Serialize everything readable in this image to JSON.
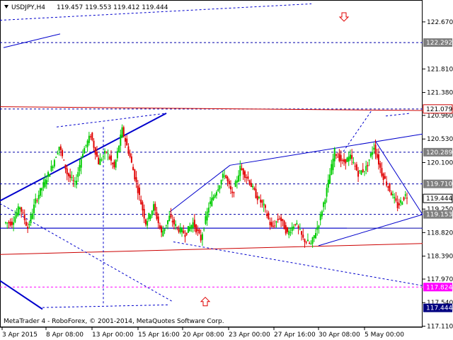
{
  "header": {
    "symbol": "USDJPY,H4",
    "ohlc": "119.457 119.553 119.412 119.444"
  },
  "footer": {
    "copyright": "MetaTrader 4 - RoboForex, © 2001-2014, MetaQuotes Software Corp."
  },
  "colors": {
    "bull": "#00cc00",
    "bear": "#e00000",
    "trend": "#0000cc",
    "support": "#cc0000",
    "target": "#ff00ff",
    "arrow": "#e00000"
  },
  "chart_data": {
    "type": "candlestick",
    "y_range": [
      117.09,
      123.07
    ],
    "y_ticks": [
      "122.670",
      "121.810",
      "121.380",
      "120.960",
      "120.530",
      "120.100",
      "119.250",
      "118.820",
      "118.390",
      "117.970",
      "117.540",
      "117.110"
    ],
    "x_labels": [
      "3 Apr 2015",
      "8 Apr 08:00",
      "13 Apr 00:00",
      "15 Apr 16:00",
      "20 Apr 08:00",
      "23 Apr 00:00",
      "27 Apr 16:00",
      "30 Apr 08:00",
      "5 May 00:00"
    ],
    "price_labels": [
      {
        "value": "122.292",
        "price": 122.292,
        "style": "gray"
      },
      {
        "value": "121.079",
        "price": 121.079,
        "style": "red"
      },
      {
        "value": "120.289",
        "price": 120.289,
        "style": "gray"
      },
      {
        "value": "119.710",
        "price": 119.71,
        "style": "gray"
      },
      {
        "value": "119.444",
        "price": 119.444,
        "style": "current"
      },
      {
        "value": "119.153",
        "price": 119.153,
        "style": "gray"
      },
      {
        "value": "117.824",
        "price": 117.824,
        "style": "magenta"
      },
      {
        "value": "117.444",
        "price": 117.444,
        "style": "navy"
      }
    ],
    "close_path": [
      119.0,
      119.3,
      118.9,
      119.4,
      119.7,
      120.0,
      120.4,
      119.9,
      119.7,
      120.3,
      120.6,
      120.1,
      120.3,
      120.0,
      120.7,
      120.2,
      119.6,
      119.0,
      119.3,
      118.8,
      119.1,
      118.9,
      118.8,
      119.0,
      118.7,
      119.3,
      119.6,
      119.9,
      119.5,
      120.0,
      119.8,
      119.5,
      119.3,
      118.9,
      119.1,
      118.8,
      119.0,
      118.7,
      118.6,
      119.0,
      119.6,
      120.3,
      120.1,
      120.2,
      119.9,
      120.0,
      120.4,
      119.9,
      119.6,
      119.3,
      119.5,
      119.44
    ],
    "horizontal_levels": [
      {
        "price": 122.292,
        "style": "dashed"
      },
      {
        "price": 121.079,
        "style": "dashed"
      },
      {
        "price": 120.289,
        "style": "dashed"
      },
      {
        "price": 119.71,
        "style": "dashed"
      },
      {
        "price": 119.153,
        "style": "dashed"
      },
      {
        "price": 118.9,
        "style": "solid"
      },
      {
        "price": 117.824,
        "style": "dashed-magenta"
      }
    ],
    "forecast_arrows": [
      {
        "direction": "down",
        "price": 122.76
      },
      {
        "direction": "up",
        "price": 117.56
      }
    ]
  }
}
